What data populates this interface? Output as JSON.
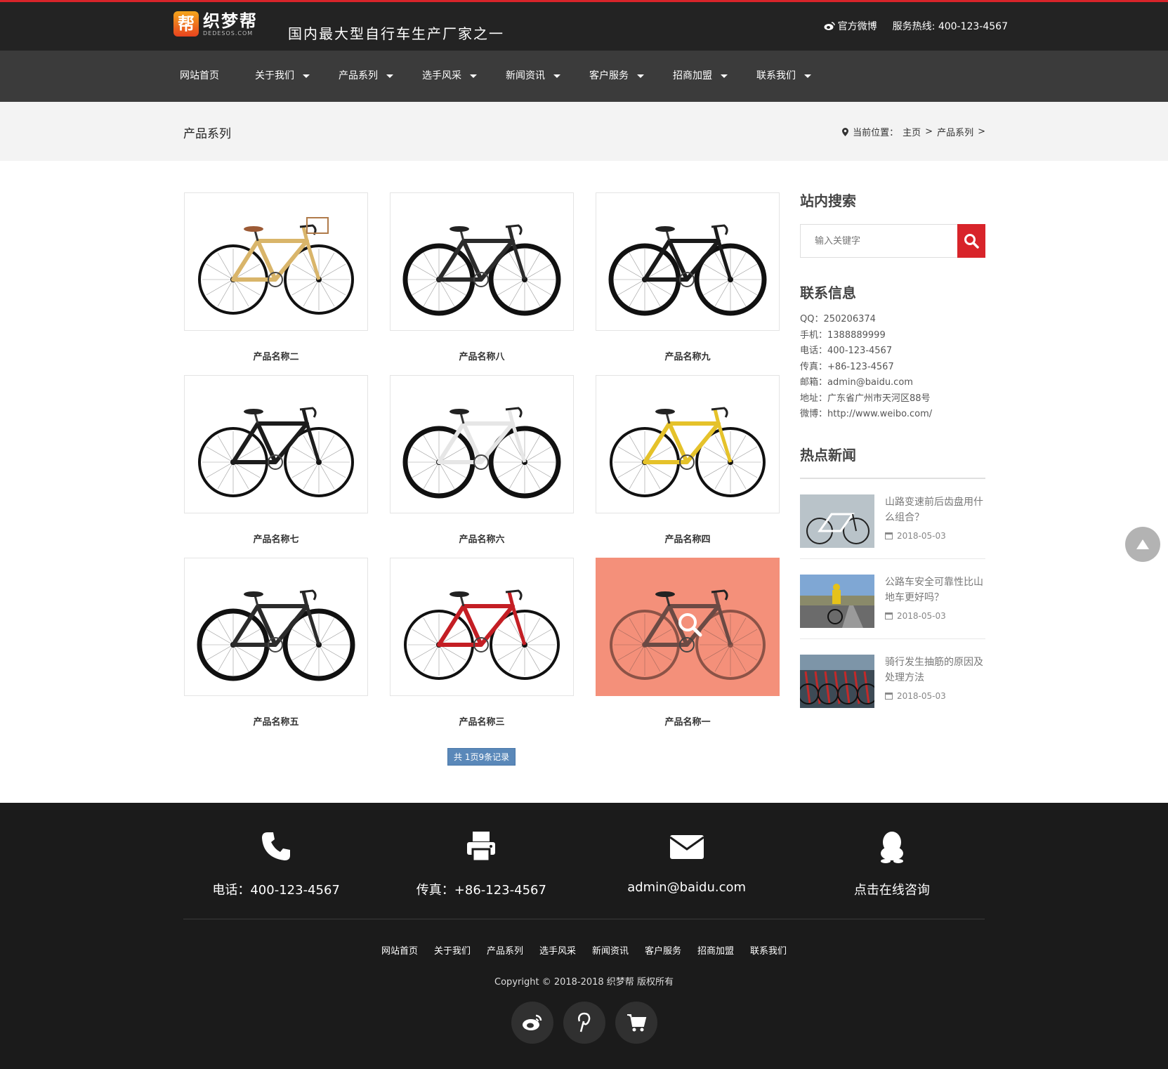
{
  "header": {
    "logo_mark": "帮",
    "logo_text": "织梦帮",
    "logo_sub": "DEDESOS.COM",
    "slogan": "国内最大型自行车生产厂家之一",
    "weibo_label": "官方微博",
    "hotline_label": "服务热线:",
    "hotline_number": "400-123-4567"
  },
  "nav": [
    {
      "label": "网站首页",
      "caret": false
    },
    {
      "label": "关于我们",
      "caret": true
    },
    {
      "label": "产品系列",
      "caret": true
    },
    {
      "label": "选手风采",
      "caret": true
    },
    {
      "label": "新闻资讯",
      "caret": true
    },
    {
      "label": "客户服务",
      "caret": true
    },
    {
      "label": "招商加盟",
      "caret": true
    },
    {
      "label": "联系我们",
      "caret": true
    }
  ],
  "band": {
    "title": "产品系列",
    "crumb_label": "当前位置：",
    "crumb_home": "主页",
    "crumb_sep1": ">",
    "crumb_current": "产品系列",
    "crumb_sep2": ">"
  },
  "products": [
    {
      "name": "产品名称二",
      "frame": "#d9b56a",
      "style": "city"
    },
    {
      "name": "产品名称八",
      "frame": "#2b2b2b",
      "style": "mtb"
    },
    {
      "name": "产品名称九",
      "frame": "#1a1a1a",
      "style": "mtb"
    },
    {
      "name": "产品名称七",
      "frame": "#1c1c1c",
      "style": "road"
    },
    {
      "name": "产品名称六",
      "frame": "#e6e6e6",
      "style": "mtb"
    },
    {
      "name": "产品名称四",
      "frame": "#e5c22a",
      "style": "road"
    },
    {
      "name": "产品名称五",
      "frame": "#2b2b2b",
      "style": "mtb"
    },
    {
      "name": "产品名称三",
      "frame": "#c41e24",
      "style": "road"
    },
    {
      "name": "产品名称一",
      "frame": "#6b4a44",
      "style": "road"
    }
  ],
  "pager": "共 1页9条记录",
  "sidebar": {
    "search_title": "站内搜索",
    "search_placeholder": "输入关键字",
    "contact_title": "联系信息",
    "contact_lines": [
      "QQ：250206374",
      "手机：1388889999",
      "电话：400-123-4567",
      "传真：+86-123-4567",
      "邮箱：admin@baidu.com",
      "地址：广东省广州市天河区88号",
      "微博：http://www.weibo.com/"
    ],
    "news_title": "热点新闻",
    "news": [
      {
        "title": "山路变速前后齿盘用什么组合？",
        "date": "2018-05-03"
      },
      {
        "title": "公路车安全可靠性比山地车更好吗？",
        "date": "2018-05-03"
      },
      {
        "title": "骑行发生抽筋的原因及处理方法",
        "date": "2018-05-03"
      }
    ]
  },
  "footer": {
    "items": [
      {
        "icon": "phone-icon",
        "label": "电话：400-123-4567"
      },
      {
        "icon": "printer-icon",
        "label": "传真：+86-123-4567"
      },
      {
        "icon": "envelope-icon",
        "label": "admin@baidu.com"
      },
      {
        "icon": "qq-icon",
        "label": "点击在线咨询"
      }
    ],
    "links": [
      "网站首页",
      "关于我们",
      "产品系列",
      "选手风采",
      "新闻资讯",
      "客户服务",
      "招商加盟",
      "联系我们"
    ],
    "copyright": "Copyright © 2018-2018 织梦帮 版权所有",
    "social": [
      "weibo-icon",
      "pinterest-icon",
      "cart-icon"
    ]
  },
  "colors": {
    "accent_red": "#d8242a",
    "topbar": "#232323",
    "nav": "#3b3b3b",
    "footer": "#1b1b1b",
    "hover_overlay": "#f4907a",
    "pager": "#5a88b9"
  }
}
